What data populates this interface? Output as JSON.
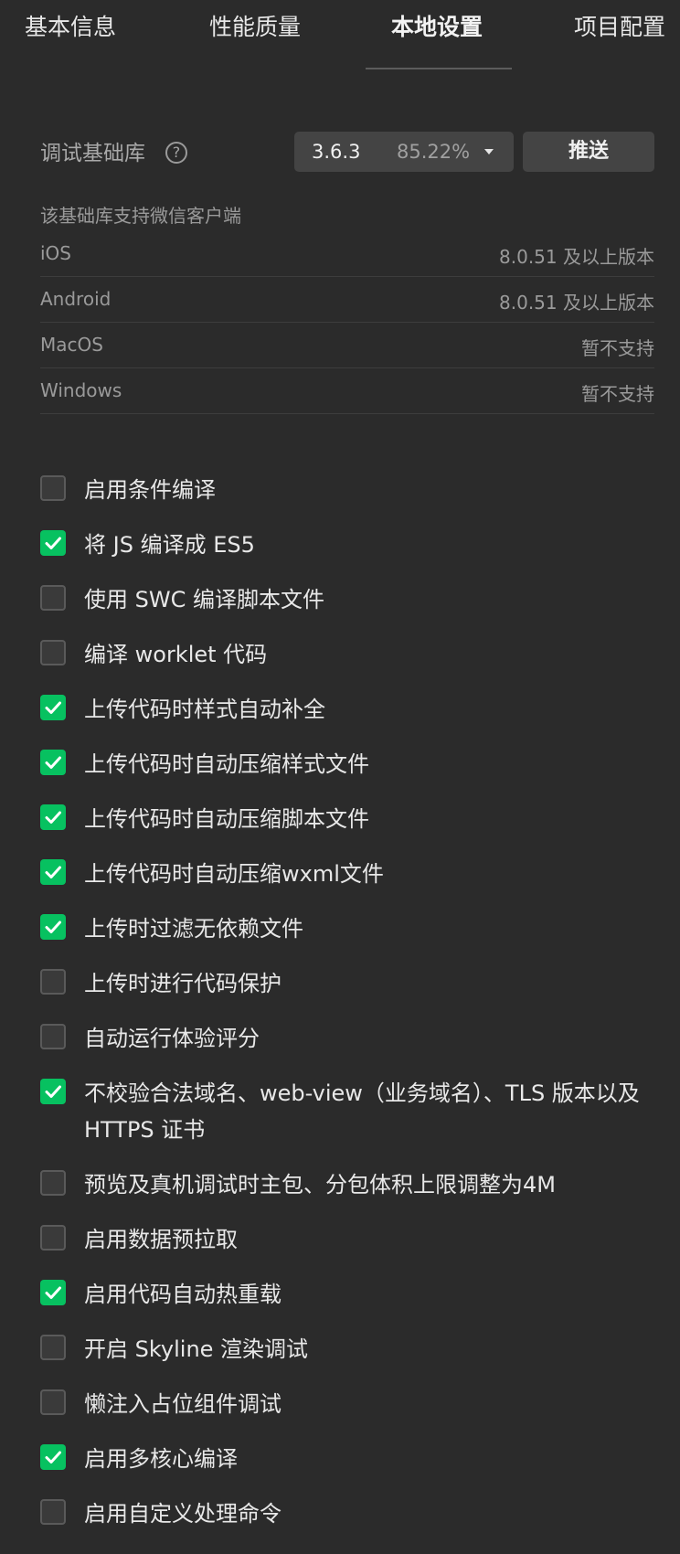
{
  "tabs": [
    {
      "label": "基本信息",
      "active": false
    },
    {
      "label": "性能质量",
      "active": false
    },
    {
      "label": "本地设置",
      "active": true
    },
    {
      "label": "项目配置",
      "active": false
    }
  ],
  "debug_library": {
    "label": "调试基础库",
    "help_icon": "question-circle-icon",
    "version": "3.6.3",
    "coverage": "85.22%",
    "dropdown_icon": "caret-down-icon",
    "push_label": "推送"
  },
  "client_support": {
    "caption": "该基础库支持微信客户端",
    "rows": [
      {
        "platform": "iOS",
        "requirement": "8.0.51 及以上版本"
      },
      {
        "platform": "Android",
        "requirement": "8.0.51 及以上版本"
      },
      {
        "platform": "MacOS",
        "requirement": "暂不支持"
      },
      {
        "platform": "Windows",
        "requirement": "暂不支持"
      }
    ]
  },
  "colors": {
    "background": "#2b2b2b",
    "checked": "#07c160",
    "button": "#444444"
  },
  "options": [
    {
      "label": "启用条件编译",
      "checked": false
    },
    {
      "label": "将 JS 编译成 ES5",
      "checked": true
    },
    {
      "label": "使用 SWC 编译脚本文件",
      "checked": false
    },
    {
      "label": "编译 worklet 代码",
      "checked": false
    },
    {
      "label": "上传代码时样式自动补全",
      "checked": true
    },
    {
      "label": "上传代码时自动压缩样式文件",
      "checked": true
    },
    {
      "label": "上传代码时自动压缩脚本文件",
      "checked": true
    },
    {
      "label": "上传代码时自动压缩wxml文件",
      "checked": true
    },
    {
      "label": "上传时过滤无依赖文件",
      "checked": true
    },
    {
      "label": "上传时进行代码保护",
      "checked": false
    },
    {
      "label": "自动运行体验评分",
      "checked": false
    },
    {
      "label": "不校验合法域名、web-view（业务域名）、TLS 版本以及 HTTPS 证书",
      "checked": true
    },
    {
      "label": "预览及真机调试时主包、分包体积上限调整为4M",
      "checked": false
    },
    {
      "label": "启用数据预拉取",
      "checked": false
    },
    {
      "label": "启用代码自动热重载",
      "checked": true
    },
    {
      "label": "开启 Skyline 渲染调试",
      "checked": false
    },
    {
      "label": "懒注入占位组件调试",
      "checked": false
    },
    {
      "label": "启用多核心编译",
      "checked": true
    },
    {
      "label": "启用自定义处理命令",
      "checked": false
    }
  ]
}
